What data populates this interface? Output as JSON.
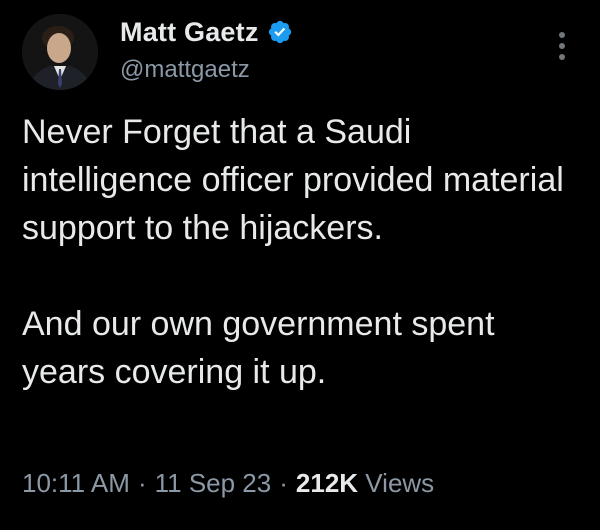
{
  "author": {
    "display_name": "Matt Gaetz",
    "handle": "@mattgaetz",
    "verified": true
  },
  "tweet": {
    "paragraph_1": "Never Forget that a Saudi intelligence officer provided material support to the hijackers.",
    "paragraph_2": "And our own government spent years covering it up."
  },
  "meta": {
    "time": "10:11 AM",
    "separator": "·",
    "date": "11 Sep 23",
    "views_count": "212K",
    "views_label": "Views"
  },
  "icons": {
    "verified": "verified-badge-icon",
    "more": "more-options-icon"
  },
  "colors": {
    "background": "#000000",
    "primary_text": "#e7e9ea",
    "secondary_text": "#8b98a5",
    "verified_blue": "#1d9bf0"
  }
}
